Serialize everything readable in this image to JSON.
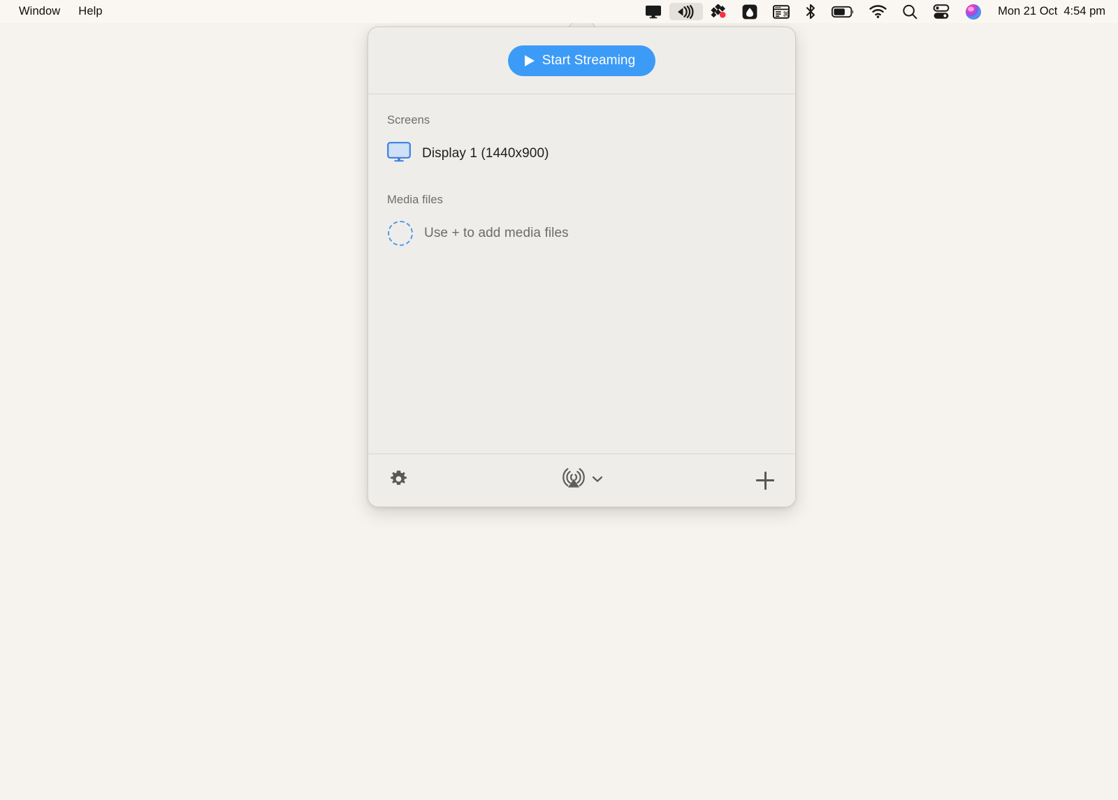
{
  "menubar": {
    "left_items": [
      {
        "label": "Window",
        "name": "menu-window"
      },
      {
        "label": "Help",
        "name": "menu-help"
      }
    ],
    "status_icons": [
      {
        "name": "display-mirroring-icon",
        "active": false
      },
      {
        "name": "streaming-icon",
        "active": true
      },
      {
        "name": "diamonds-app-icon",
        "active": false
      },
      {
        "name": "droplet-app-icon",
        "active": false
      },
      {
        "name": "window-shortcut-icon",
        "active": false
      },
      {
        "name": "bluetooth-icon",
        "active": false
      },
      {
        "name": "battery-icon",
        "active": false
      },
      {
        "name": "wifi-icon",
        "active": false
      },
      {
        "name": "search-icon",
        "active": false
      },
      {
        "name": "control-center-icon",
        "active": false
      },
      {
        "name": "siri-icon",
        "active": false
      }
    ],
    "clock": {
      "date": "Mon 21 Oct",
      "time": "4:54 pm"
    }
  },
  "popover": {
    "start_button_label": "Start Streaming",
    "sections": {
      "screens": {
        "title": "Screens",
        "items": [
          {
            "label": "Display 1 (1440x900)",
            "icon": "display-icon"
          }
        ]
      },
      "media_files": {
        "title": "Media files",
        "placeholder_label": "Use + to add media files",
        "placeholder_icon": "dashed-circle-icon"
      }
    },
    "footer": {
      "settings_icon": "gear-icon",
      "output_icon": "airplay-broadcast-icon",
      "output_chevron_icon": "chevron-down-icon",
      "add_icon": "plus-icon"
    }
  },
  "colors": {
    "desktop_background": "#F6F2ED",
    "menubar_background": "#FAF7F2",
    "popover_background": "#EFEDEA",
    "accent_blue": "#3C9BF7",
    "display_icon_blue": "#3C7FE0",
    "dashed_circle_blue": "#4E9AEC",
    "section_title_gray": "#6E6E6E",
    "icon_gray": "#585858"
  }
}
